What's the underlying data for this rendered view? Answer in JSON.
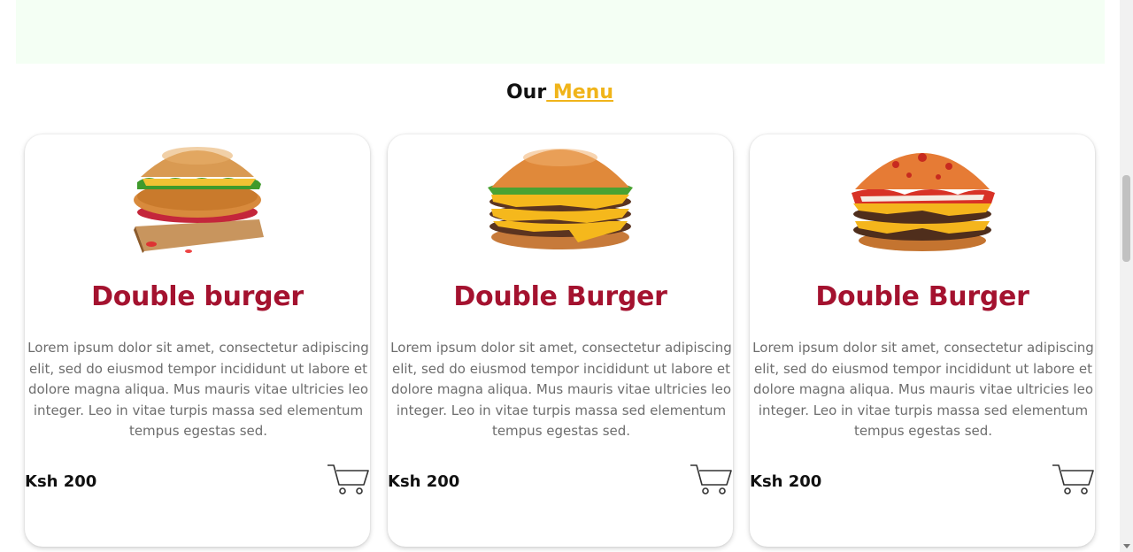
{
  "section": {
    "title_prefix": "Our",
    "title_accent": " Menu"
  },
  "cards": [
    {
      "title": "Double burger",
      "description": "Lorem ipsum dolor sit amet, consectetur adipiscing elit, sed do eiusmod tempor incididunt ut labore et dolore magna aliqua. Mus mauris vitae ultricies leo integer. Leo in vitae turpis massa sed elementum tempus egestas sed.",
      "price": "Ksh 200",
      "image": "crispy-chicken-burger"
    },
    {
      "title": "Double Burger",
      "description": "Lorem ipsum dolor sit amet, consectetur adipiscing elit, sed do eiusmod tempor incididunt ut labore et dolore magna aliqua. Mus mauris vitae ultricies leo integer. Leo in vitae turpis massa sed elementum tempus egestas sed.",
      "price": "Ksh 200",
      "image": "double-cheeseburger"
    },
    {
      "title": "Double Burger",
      "description": "Lorem ipsum dolor sit amet, consectetur adipiscing elit, sed do eiusmod tempor incididunt ut labore et dolore magna aliqua. Mus mauris vitae ultricies leo integer. Leo in vitae turpis massa sed elementum tempus egestas sed.",
      "price": "Ksh 200",
      "image": "bacon-cheeseburger"
    }
  ],
  "colors": {
    "accent": "#f0b41a",
    "title": "#a4122f",
    "band": "#f4fff4"
  }
}
